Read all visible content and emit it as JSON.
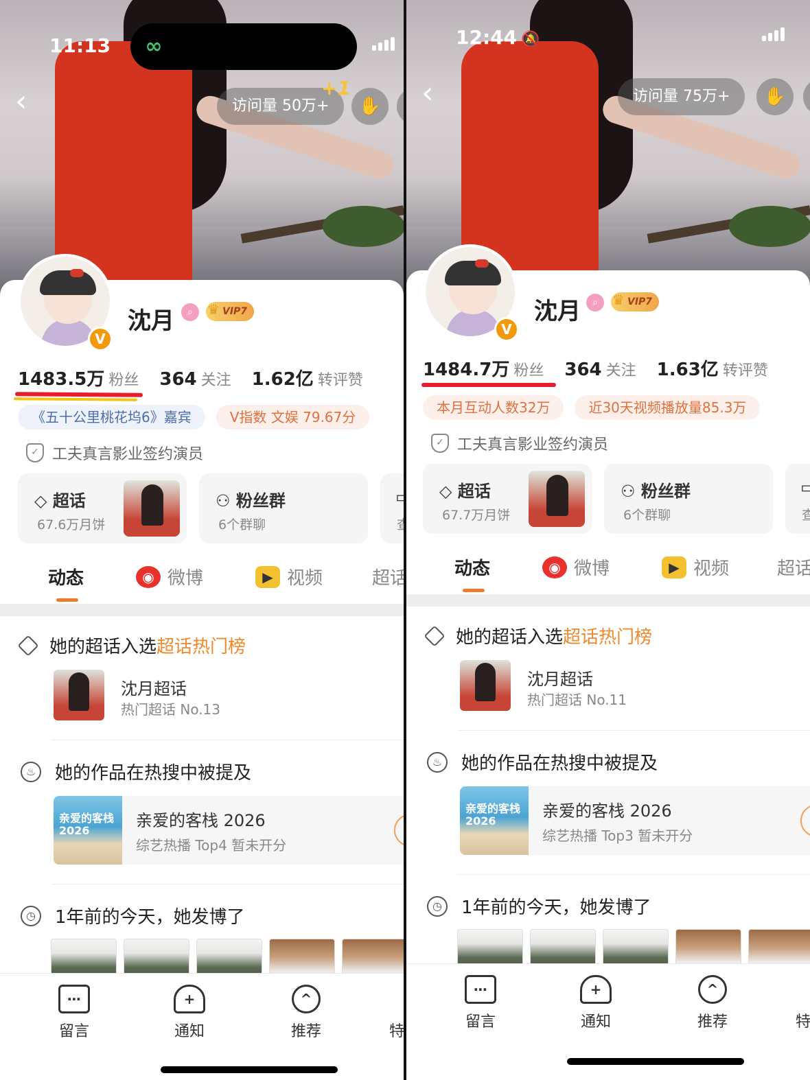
{
  "left": {
    "status": {
      "time": "11:13"
    },
    "visits": "访问量 50万+",
    "visits_bonus": "+1",
    "profile": {
      "name": "沈月",
      "vip": "VIP7",
      "verified": "V",
      "fans_num": "1483.5万",
      "fans_label": "粉丝",
      "follow_num": "364",
      "follow_label": "关注",
      "likes_num": "1.62亿",
      "likes_label": "转评赞"
    },
    "tags": [
      "《五十公里桃花坞6》嘉宾",
      "V指数 文娱 79.67分"
    ],
    "signed": "工夫真言影业签约演员",
    "tiles": [
      {
        "title": "超话",
        "sub": "67.6万月饼"
      },
      {
        "title": "粉丝群",
        "sub": "6个群聊"
      },
      {
        "title": "",
        "sub": "查"
      }
    ],
    "tabs": [
      "动态",
      "微博",
      "视频",
      "超话"
    ],
    "feed": {
      "s1_prefix": "她的超话入选",
      "s1_highlight": "超话热门榜",
      "s1_item_title": "沈月超话",
      "s1_item_sub": "热门超话 No.13",
      "s2_title": "她的作品在热搜中被提及",
      "s2_show_title": "亲爱的客栈 2026",
      "s2_show_sub": "综艺热播 Top4 暂未开分",
      "s2_thumb_text": "亲爱的客栈 2026",
      "s3_title": "1年前的今天，她发博了"
    },
    "bottom": [
      "留言",
      "通知",
      "推荐",
      "特"
    ]
  },
  "right": {
    "status": {
      "time": "12:44"
    },
    "visits": "访问量 75万+",
    "profile": {
      "name": "沈月",
      "vip": "VIP7",
      "verified": "V",
      "fans_num": "1484.7万",
      "fans_label": "粉丝",
      "follow_num": "364",
      "follow_label": "关注",
      "likes_num": "1.63亿",
      "likes_label": "转评赞"
    },
    "tags": [
      "本月互动人数32万",
      "近30天视频播放量85.3万"
    ],
    "signed": "工夫真言影业签约演员",
    "tiles": [
      {
        "title": "超话",
        "sub": "67.7万月饼"
      },
      {
        "title": "粉丝群",
        "sub": "6个群聊"
      },
      {
        "title": "",
        "sub": "查"
      }
    ],
    "tabs": [
      "动态",
      "微博",
      "视频",
      "超话"
    ],
    "feed": {
      "s1_prefix": "她的超话入选",
      "s1_highlight": "超话热门榜",
      "s1_item_title": "沈月超话",
      "s1_item_sub": "热门超话 No.11",
      "s2_title": "她的作品在热搜中被提及",
      "s2_show_title": "亲爱的客栈 2026",
      "s2_show_sub": "综艺热播 Top3 暂未开分",
      "s2_thumb_text": "亲爱的客栈 2026",
      "s3_title": "1年前的今天，她发博了"
    },
    "bottom": [
      "留言",
      "通知",
      "推荐",
      "特"
    ]
  },
  "colors": {
    "accent": "#f07a2b",
    "weibo_red": "#e8312d",
    "underline_red": "#e81d2b",
    "vip_gold": "#f1a54a"
  }
}
